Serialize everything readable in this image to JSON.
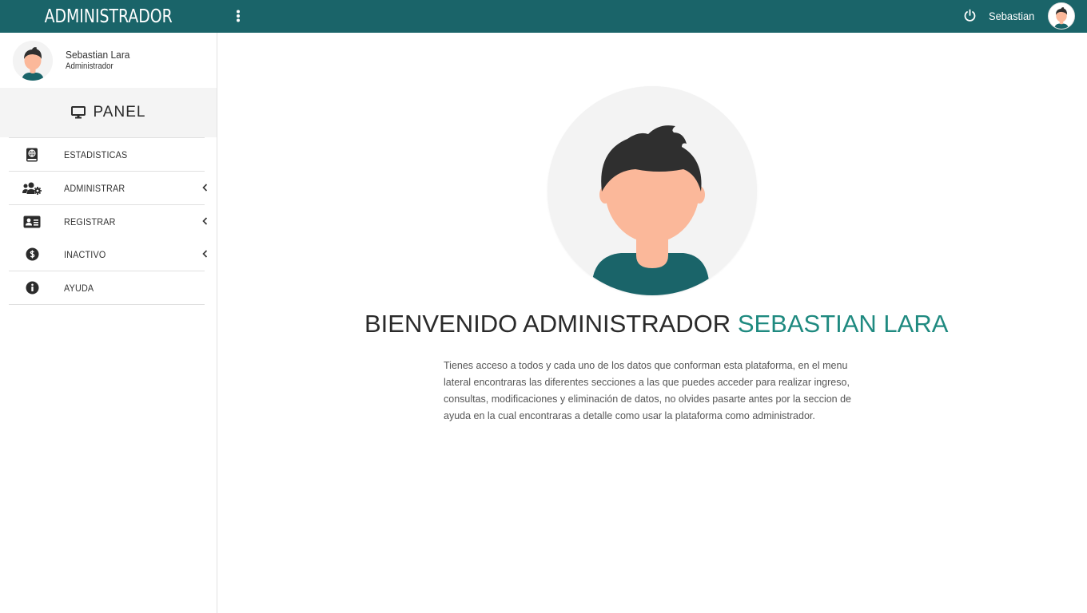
{
  "sidebar": {
    "brand": "ADMINISTRADOR",
    "profile": {
      "name": "Sebastian Lara",
      "role": "Administrador"
    },
    "panel_label": "PANEL",
    "items": [
      {
        "label": "ESTADISTICAS",
        "icon": "book-globe-icon",
        "has_submenu": false
      },
      {
        "label": "ADMINISTRAR",
        "icon": "users-cog-icon",
        "has_submenu": true
      },
      {
        "label": "REGISTRAR",
        "icon": "id-card-icon",
        "has_submenu": true
      },
      {
        "label": "INACTIVO",
        "icon": "dollar-circle-icon",
        "has_submenu": true
      },
      {
        "label": "AYUDA",
        "icon": "info-circle-icon",
        "has_submenu": false
      }
    ]
  },
  "topbar": {
    "user_name": "Sebastian",
    "menu_icon": "kebab-menu-icon",
    "logout_icon": "power-icon"
  },
  "main": {
    "welcome_prefix": "BIENVENIDO ADMINISTRADOR",
    "welcome_name": "SEBASTIAN LARA",
    "description": "Tienes acceso a todos y cada uno de los datos que conforman esta plataforma, en el menu lateral encontraras las diferentes secciones a las que puedes acceder para realizar ingreso, consultas, modificaciones y eliminación de datos, no olvides pasarte antes por la seccion de ayuda en la cual encontraras a detalle como usar la plataforma como administrador."
  },
  "colors": {
    "primary": "#1a6469",
    "accent": "#1f8a80",
    "skin": "#fbb89a",
    "hair": "#2f2f2f",
    "shirt": "#1a6469"
  }
}
